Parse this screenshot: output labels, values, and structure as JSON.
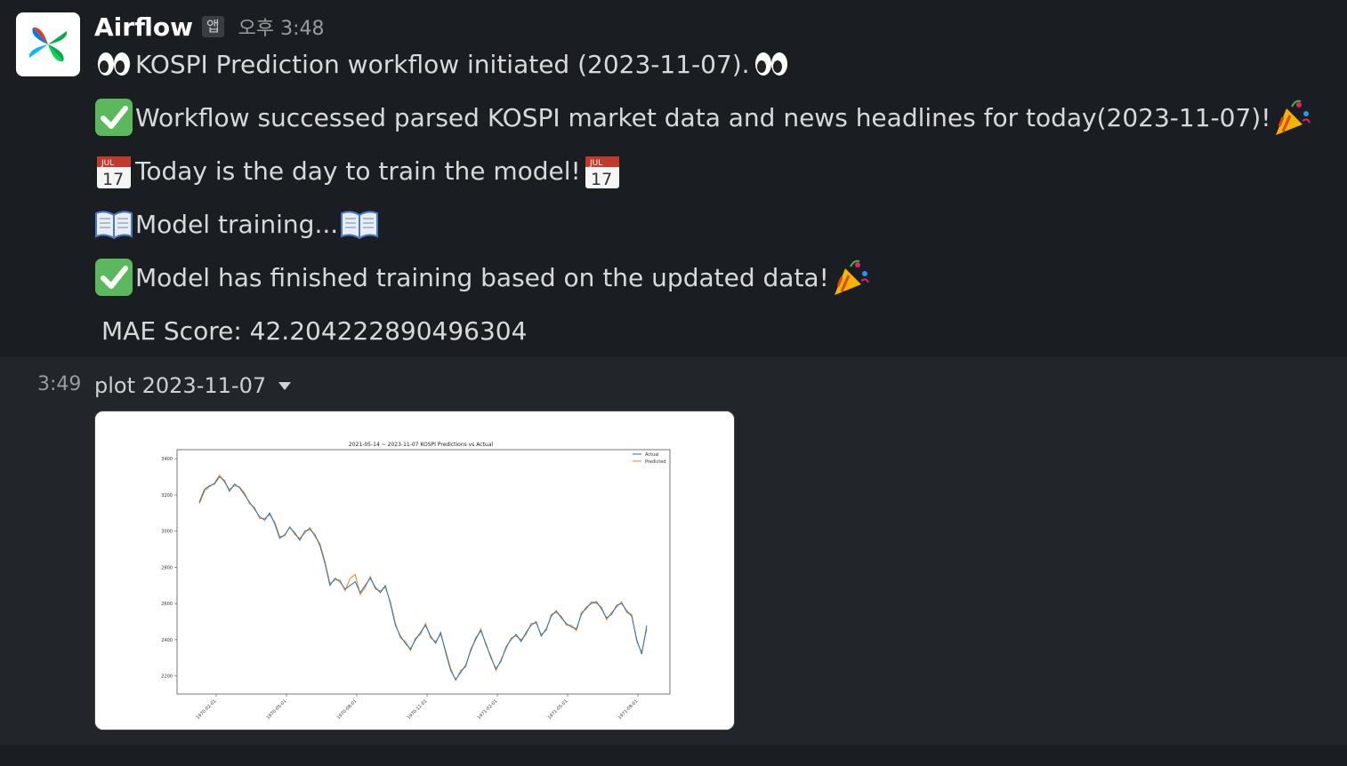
{
  "message": {
    "sender": "Airflow",
    "app_badge": "앱",
    "time": "오후 3:48",
    "lines": [
      {
        "pre_icon": "eyes-emoji",
        "text": "KOSPI Prediction workflow initiated (2023-11-07).",
        "post_icon": "eyes-emoji"
      },
      {
        "pre_icon": "check-mark-emoji",
        "text": "Workflow successed parsed KOSPI market data and news headlines for today(2023-11-07)!",
        "post_icon": "party-popper-emoji"
      },
      {
        "pre_icon": "calendar-emoji",
        "text": "Today is the day to train the model!",
        "post_icon": "calendar-emoji"
      },
      {
        "pre_icon": "open-book-emoji",
        "text": "Model training...",
        "post_icon": "open-book-emoji"
      },
      {
        "pre_icon": "check-mark-emoji",
        "text": "Model has finished training based on the updated data!",
        "post_icon": "party-popper-emoji"
      },
      {
        "pre_icon": "",
        "text": "MAE Score: 42.204222890496304",
        "post_icon": ""
      }
    ],
    "calendar_month": "JUL",
    "calendar_day": "17"
  },
  "attachment": {
    "time": "3:49",
    "name": "plot 2023-11-07",
    "caret_icon": "caret-down-icon"
  },
  "chart_data": {
    "type": "line",
    "title": "2021-05-14 ~ 2023-11-07 KOSPI Predictions vs Actual",
    "xlabel": "",
    "ylabel": "",
    "x_ticks": [
      "1970-02-01",
      "1970-05-01",
      "1970-08-01",
      "1970-11-01",
      "1971-02-01",
      "1971-05-01",
      "1971-08-01"
    ],
    "y_ticks": [
      2200,
      2400,
      2600,
      2800,
      3000,
      3200,
      3400
    ],
    "ylim": [
      2100,
      3450
    ],
    "legend_position": "top-right",
    "colors": {
      "Actual": "#1f77b4",
      "Predicted": "#ff7f0e"
    },
    "series": [
      {
        "name": "Actual",
        "values": [
          3160,
          3230,
          3250,
          3260,
          3300,
          3280,
          3220,
          3260,
          3240,
          3200,
          3160,
          3120,
          3080,
          3060,
          3100,
          3040,
          2960,
          2980,
          3020,
          2990,
          2950,
          3000,
          3010,
          2980,
          2920,
          2820,
          2700,
          2740,
          2720,
          2680,
          2700,
          2720,
          2660,
          2700,
          2740,
          2690,
          2660,
          2700,
          2600,
          2480,
          2420,
          2380,
          2350,
          2400,
          2440,
          2480,
          2420,
          2380,
          2440,
          2330,
          2230,
          2180,
          2220,
          2260,
          2340,
          2410,
          2450,
          2380,
          2300,
          2240,
          2280,
          2360,
          2400,
          2430,
          2390,
          2440,
          2480,
          2500,
          2420,
          2460,
          2530,
          2560,
          2520,
          2490,
          2470,
          2460,
          2540,
          2580,
          2600,
          2610,
          2570,
          2520,
          2540,
          2590,
          2600,
          2560,
          2530,
          2400,
          2320,
          2480
        ]
      },
      {
        "name": "Predicted",
        "values": [
          3150,
          3220,
          3245,
          3265,
          3310,
          3270,
          3230,
          3250,
          3245,
          3210,
          3150,
          3130,
          3070,
          3070,
          3090,
          3050,
          2970,
          2975,
          3025,
          2980,
          2960,
          2990,
          3020,
          2970,
          2930,
          2830,
          2710,
          2730,
          2730,
          2670,
          2740,
          2760,
          2650,
          2690,
          2750,
          2680,
          2670,
          2690,
          2610,
          2490,
          2410,
          2390,
          2340,
          2410,
          2430,
          2490,
          2410,
          2390,
          2430,
          2340,
          2240,
          2175,
          2230,
          2250,
          2350,
          2400,
          2460,
          2370,
          2310,
          2230,
          2290,
          2350,
          2410,
          2420,
          2400,
          2430,
          2490,
          2490,
          2430,
          2450,
          2540,
          2550,
          2530,
          2480,
          2480,
          2450,
          2550,
          2570,
          2610,
          2600,
          2580,
          2510,
          2550,
          2580,
          2610,
          2550,
          2540,
          2390,
          2330,
          2460
        ]
      }
    ]
  }
}
